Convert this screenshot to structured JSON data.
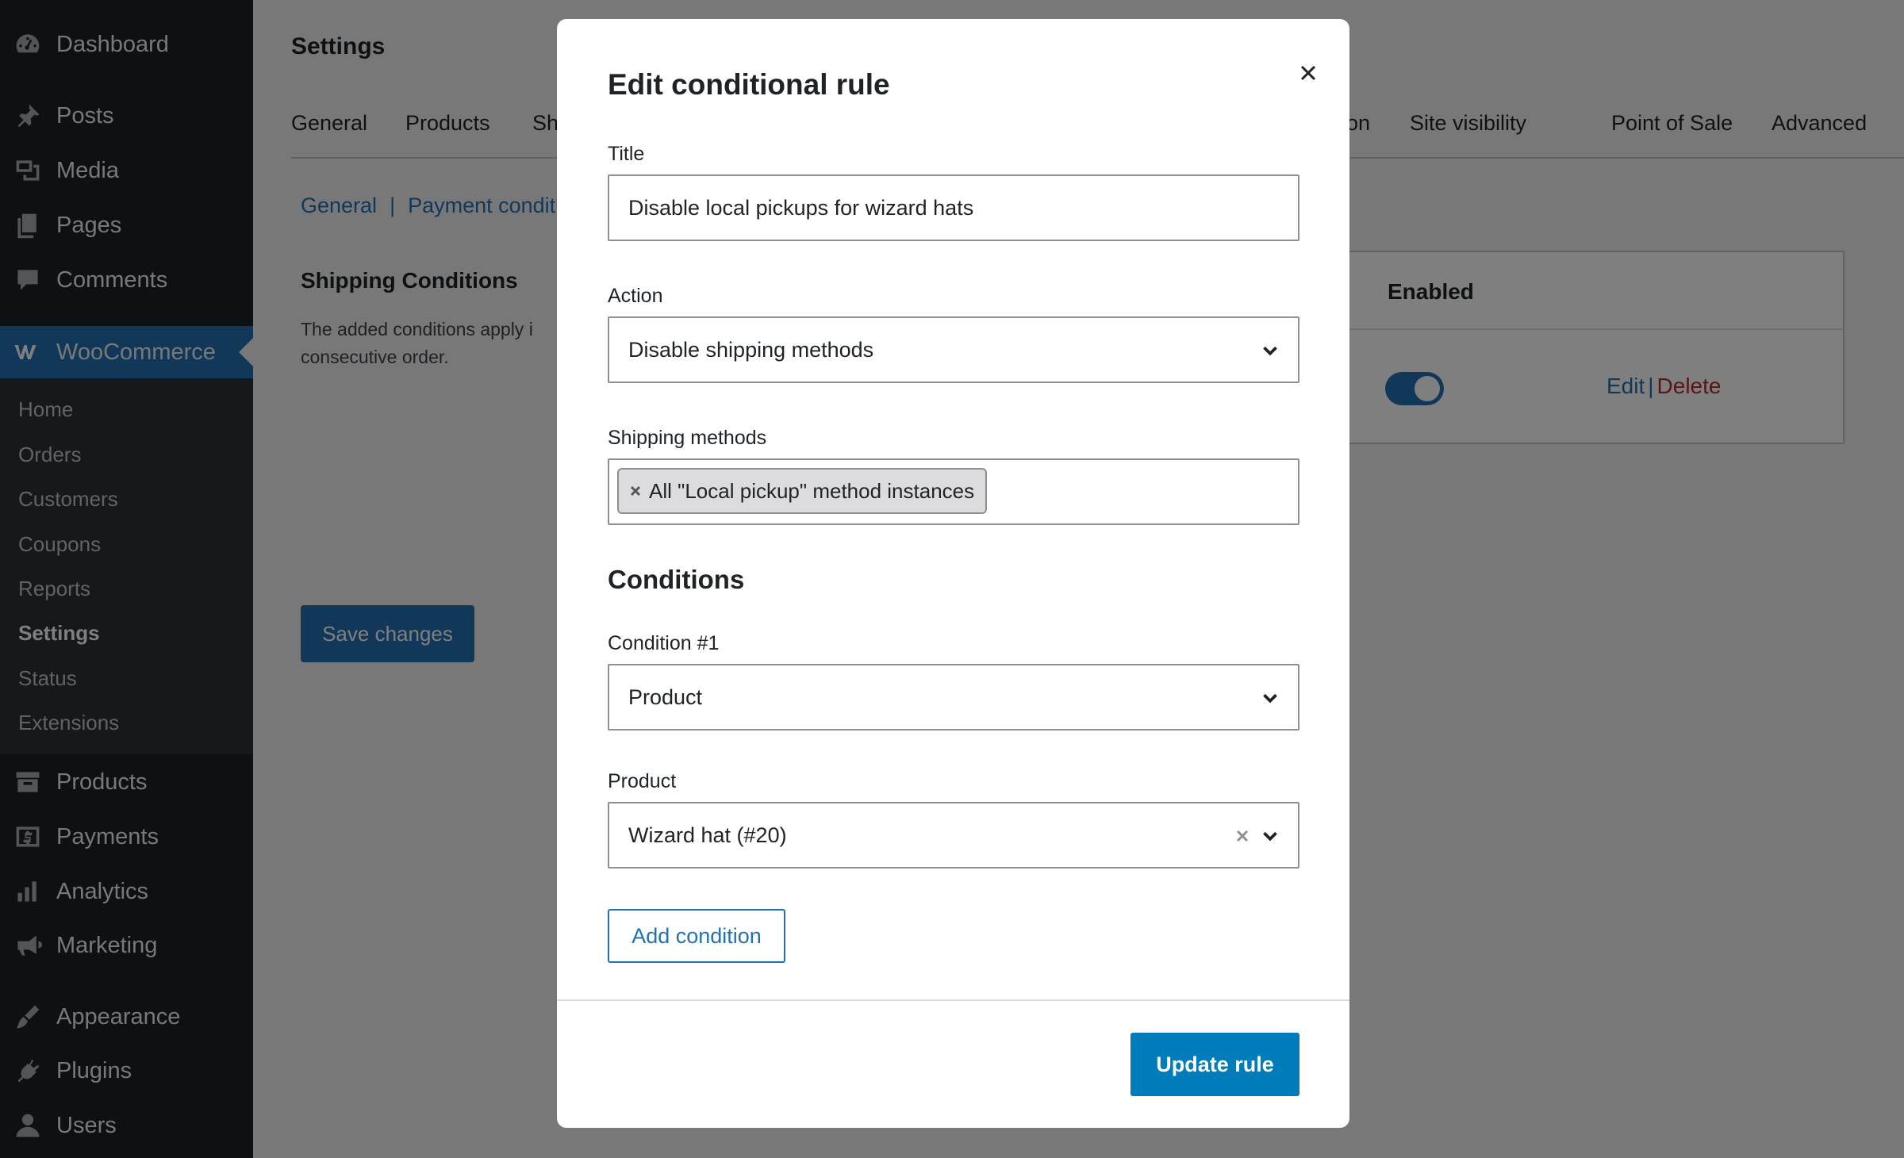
{
  "sidebar": {
    "menu": [
      {
        "label": "Dashboard",
        "icon": "dashboard-icon"
      },
      {
        "label": "Posts",
        "icon": "pin-icon"
      },
      {
        "label": "Media",
        "icon": "media-icon"
      },
      {
        "label": "Pages",
        "icon": "pages-icon"
      },
      {
        "label": "Comments",
        "icon": "comment-icon"
      },
      {
        "label": "WooCommerce",
        "icon": "woocommerce-icon"
      },
      {
        "label": "Products",
        "icon": "archive-icon"
      },
      {
        "label": "Payments",
        "icon": "dollar-icon"
      },
      {
        "label": "Analytics",
        "icon": "bar-chart-icon"
      },
      {
        "label": "Marketing",
        "icon": "megaphone-icon"
      },
      {
        "label": "Appearance",
        "icon": "brush-icon"
      },
      {
        "label": "Plugins",
        "icon": "plug-icon"
      },
      {
        "label": "Users",
        "icon": "user-icon"
      }
    ],
    "submenu": [
      "Home",
      "Orders",
      "Customers",
      "Coupons",
      "Reports",
      "Settings",
      "Status",
      "Extensions"
    ],
    "current_submenu": "Settings"
  },
  "page": {
    "title": "Settings",
    "tabs": [
      "General",
      "Products",
      "Sh",
      "on",
      "Site visibility",
      "Point of Sale",
      "Advanced"
    ],
    "breadcrumbs": [
      "General",
      "Payment conditi"
    ],
    "breadcrumb_separator": "|",
    "section_title": "Shipping Conditions",
    "section_desc": "The added conditions apply i consecutive order.",
    "save_label": "Save changes",
    "table": {
      "enabled_header": "Enabled",
      "edit_label": "Edit",
      "separator": "|",
      "delete_label": "Delete",
      "row_enabled": true
    }
  },
  "modal": {
    "title": "Edit conditional rule",
    "title_label": "Title",
    "title_value": "Disable local pickups for wizard hats",
    "action_label": "Action",
    "action_value": "Disable shipping methods",
    "methods_label": "Shipping methods",
    "methods_token": "All \"Local pickup\" method instances",
    "conditions_heading": "Conditions",
    "condition1_label": "Condition #1",
    "condition1_value": "Product",
    "product_label": "Product",
    "product_value": "Wizard hat (#20)",
    "add_condition_label": "Add condition",
    "update_label": "Update rule"
  },
  "colors": {
    "sidebar_bg": "#1d2327",
    "submenu_bg": "#2c3338",
    "accent": "#2271b1",
    "primary_button": "#007cba",
    "delete": "#b32d2e"
  }
}
